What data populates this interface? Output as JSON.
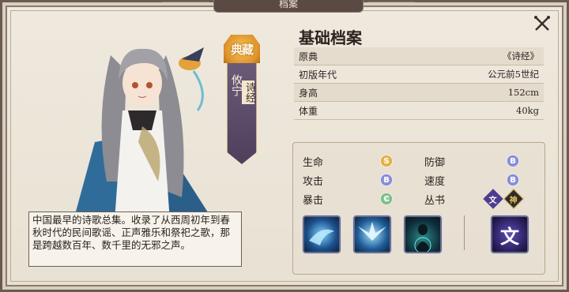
{
  "header": {
    "tab_title": "档案"
  },
  "banner": {
    "rank": "典藏",
    "name": "攸宁",
    "source": "诗经"
  },
  "profile": {
    "title": "基础档案",
    "rows": [
      {
        "label": "原典",
        "value": "《诗经》"
      },
      {
        "label": "初版年代",
        "value": "公元前5世纪"
      },
      {
        "label": "身高",
        "value": "152cm"
      },
      {
        "label": "体重",
        "value": "40kg"
      }
    ]
  },
  "stats": {
    "hp_label": "生命",
    "hp_grade": "S",
    "def_label": "防御",
    "def_grade": "B",
    "atk_label": "攻击",
    "atk_grade": "B",
    "spd_label": "速度",
    "spd_grade": "B",
    "crit_label": "暴击",
    "crit_grade": "C",
    "series_label": "丛书",
    "series_icon_1": "文",
    "series_icon_2": "神"
  },
  "skills": [
    {
      "icon": "spirit-bird-skill-icon",
      "color": "#3aa7e6"
    },
    {
      "icon": "phoenix-wings-skill-icon",
      "color": "#4cb8ef"
    },
    {
      "icon": "summon-figure-skill-icon",
      "color": "#3bc6c2"
    },
    {
      "icon": "wen-passive-icon",
      "glyph": "文",
      "color": "#6b58c9"
    }
  ],
  "description": "中国最早的诗歌总集。收录了从西周初年到春秋时代的民间歌谣、正声雅乐和祭祀之歌，那是跨越数百年、数千里的无邪之声。",
  "colors": {
    "background": "#efe9de",
    "frame": "#6a5a52",
    "banner_gold": "#e0942c",
    "banner_purple": "#4e3f5c",
    "grade_s": "#d79a29",
    "grade_b": "#6f74c7",
    "grade_c": "#5ea56a"
  }
}
